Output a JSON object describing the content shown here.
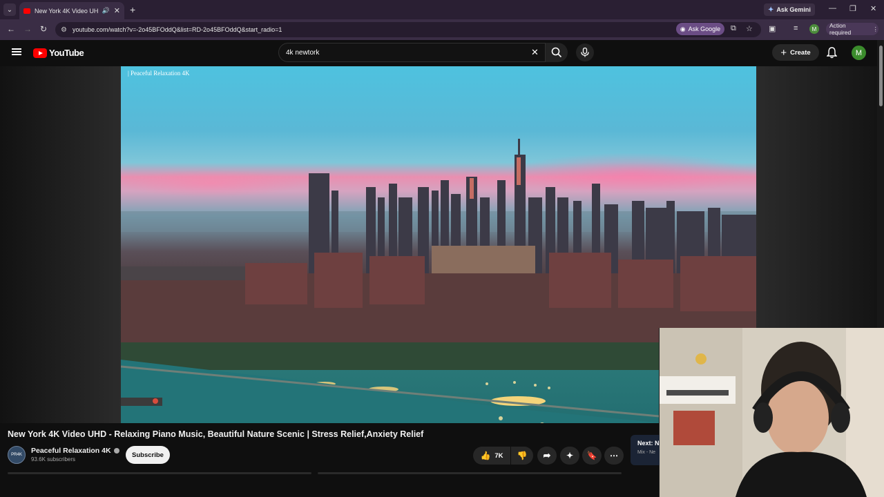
{
  "browser": {
    "tab_title": "New York 4K Video UHD - R",
    "ask_gemini": "Ask Gemini",
    "url": "youtube.com/watch?v=-2o45BFOddQ&list=RD-2o45BFOddQ&start_radio=1",
    "ask_google": "Ask Google",
    "profile_initial": "M",
    "action_required": "Action required"
  },
  "youtube": {
    "logo_text": "YouTube",
    "search_query": "4k newtork",
    "create_label": "Create",
    "avatar_initial": "M"
  },
  "video": {
    "watermark": "| Peaceful Relaxation 4K",
    "title": "New York 4K Video UHD - Relaxing Piano Music, Beautiful Nature Scenic | Stress Relief,Anxiety Relief",
    "channel_name": "Peaceful Relaxation 4K",
    "subscribers": "93.6K subscribers",
    "subscribe_label": "Subscribe",
    "likes": "7K",
    "next_title": "Next: N",
    "next_sub": "Mix - Ne"
  },
  "colors": {
    "youtube_red": "#ff0000",
    "browser_frame": "#3a2d45",
    "ask_google_bg": "#6b4d85"
  }
}
